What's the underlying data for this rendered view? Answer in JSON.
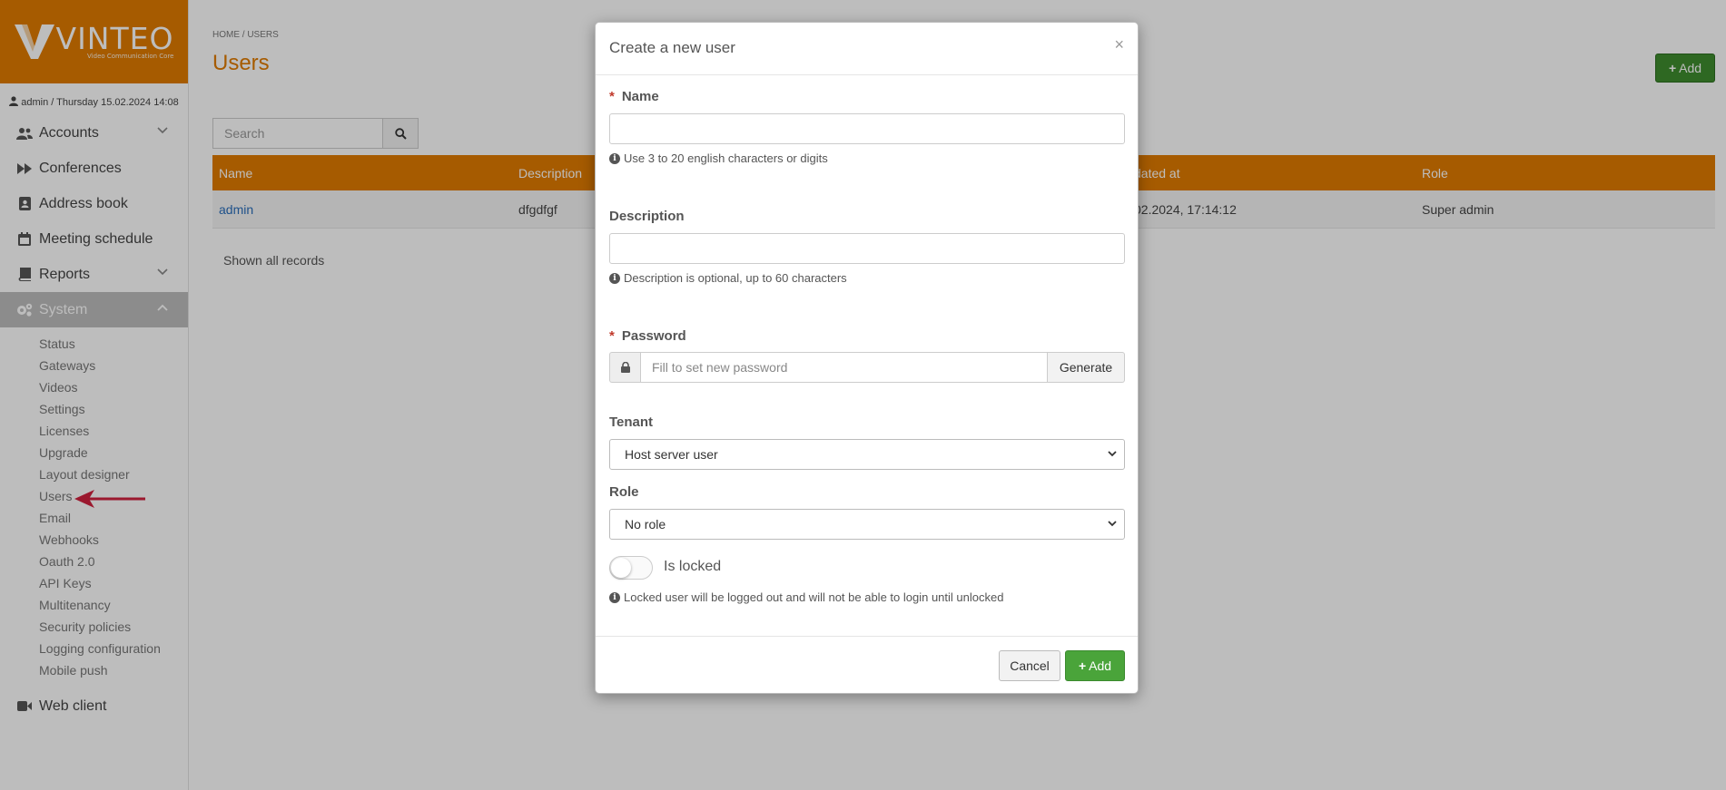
{
  "brand": {
    "name": "VINTEO",
    "tagline": "Video Communication Core",
    "color": "#e07b00"
  },
  "user_info": "admin / Thursday 15.02.2024 14:08",
  "nav": {
    "accounts": "Accounts",
    "conferences": "Conferences",
    "address_book": "Address book",
    "meeting_schedule": "Meeting schedule",
    "reports": "Reports",
    "system": "System",
    "web_client": "Web client",
    "system_items": [
      "Status",
      "Gateways",
      "Videos",
      "Settings",
      "Licenses",
      "Upgrade",
      "Layout designer",
      "Users",
      "Email",
      "Webhooks",
      "Oauth 2.0",
      "API Keys",
      "Multitenancy",
      "Security policies",
      "Logging configuration",
      "Mobile push"
    ]
  },
  "page": {
    "breadcrumb": "HOME / USERS",
    "title": "Users",
    "add_label": "Add",
    "search_placeholder": "Search",
    "columns": {
      "name": "Name",
      "description": "Description",
      "updated_at": "dated at",
      "role": "Role"
    },
    "row": {
      "name": "admin",
      "description": "dfgdfgf",
      "updated_at": "02.2024, 17:14:12",
      "role": "Super admin"
    },
    "records_text": "Shown all records"
  },
  "modal": {
    "title": "Create a new user",
    "close": "×",
    "name_label": "Name",
    "name_value": "",
    "name_help": "Use 3 to 20 english characters or digits",
    "description_label": "Description",
    "description_value": "",
    "description_help": "Description is optional, up to 60 characters",
    "password_label": "Password",
    "password_placeholder": "Fill to set new password",
    "generate_label": "Generate",
    "tenant_label": "Tenant",
    "tenant_value": "Host server user",
    "role_label": "Role",
    "role_value": "No role",
    "locked_label": "Is locked",
    "locked_on": false,
    "locked_help": "Locked user will be logged out and will not be able to login until unlocked",
    "cancel_label": "Cancel",
    "add_label": "Add"
  }
}
